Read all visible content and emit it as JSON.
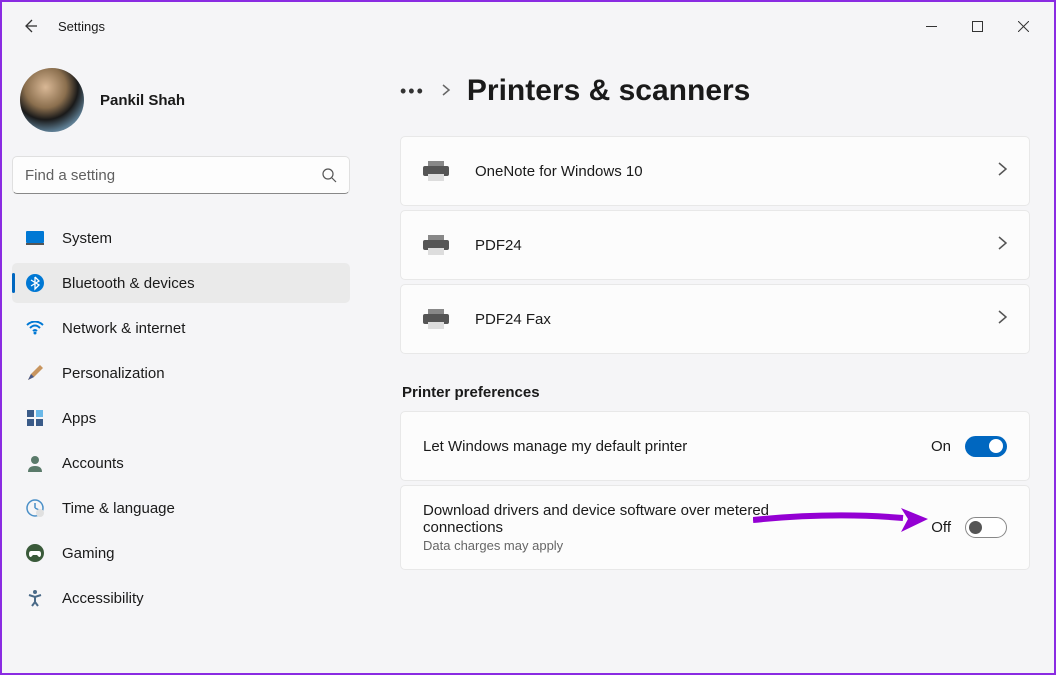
{
  "app": {
    "title": "Settings"
  },
  "profile": {
    "name": "Pankil Shah"
  },
  "search": {
    "placeholder": "Find a setting"
  },
  "nav": {
    "items": [
      {
        "label": "System",
        "icon": "system"
      },
      {
        "label": "Bluetooth & devices",
        "icon": "bluetooth",
        "active": true
      },
      {
        "label": "Network & internet",
        "icon": "wifi"
      },
      {
        "label": "Personalization",
        "icon": "brush"
      },
      {
        "label": "Apps",
        "icon": "apps"
      },
      {
        "label": "Accounts",
        "icon": "account"
      },
      {
        "label": "Time & language",
        "icon": "clock"
      },
      {
        "label": "Gaming",
        "icon": "gaming"
      },
      {
        "label": "Accessibility",
        "icon": "accessibility"
      }
    ]
  },
  "page": {
    "title": "Printers & scanners"
  },
  "printers": [
    {
      "label": "OneNote for Windows 10"
    },
    {
      "label": "PDF24"
    },
    {
      "label": "PDF24 Fax"
    }
  ],
  "preferences": {
    "header": "Printer preferences",
    "manage_default": {
      "title": "Let Windows manage my default printer",
      "state_label": "On",
      "state": true
    },
    "metered": {
      "title": "Download drivers and device software over metered connections",
      "subtitle": "Data charges may apply",
      "state_label": "Off",
      "state": false
    }
  }
}
